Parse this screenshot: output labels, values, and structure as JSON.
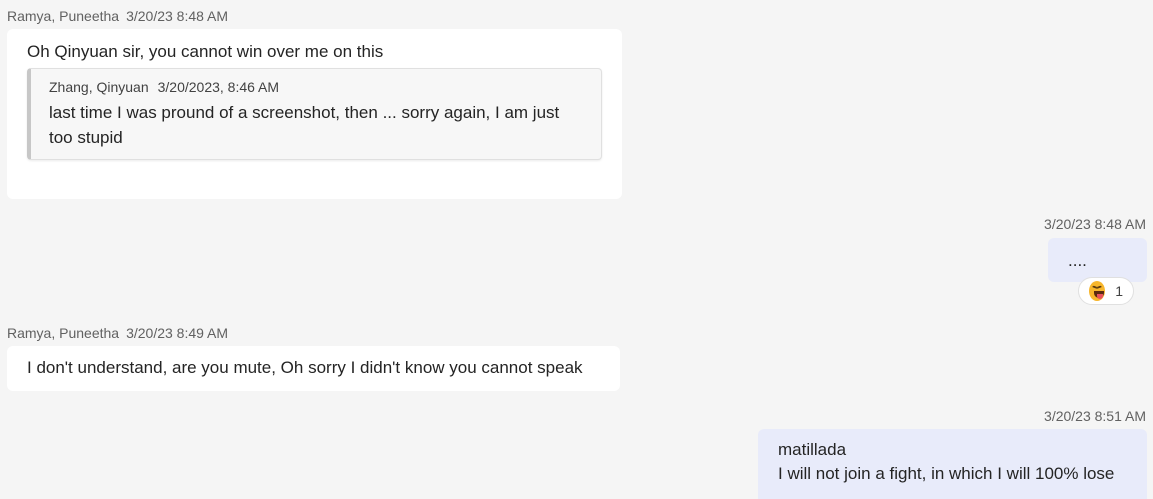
{
  "messages": [
    {
      "author": "Ramya, Puneetha",
      "time": "3/20/23 8:48 AM",
      "text": "Oh Qinyuan sir, you cannot win over me on this",
      "quote": {
        "author": "Zhang, Qinyuan",
        "time": "3/20/2023, 8:46 AM",
        "line1": "last time I was pround of a screenshot, then ... sorry again, I am just",
        "line2": "too stupid"
      }
    },
    {
      "time": "3/20/23 8:48 AM",
      "text": "....",
      "reaction": {
        "icon": "laughing-tongue-emoji-icon",
        "count": "1"
      }
    },
    {
      "author": "Ramya, Puneetha",
      "time": "3/20/23 8:49 AM",
      "text": "I don't understand, are you mute, Oh sorry I didn't know you cannot speak"
    },
    {
      "time": "3/20/23 8:51 AM",
      "line1": "matillada",
      "line2": "I will not join a fight, in which I will 100% lose"
    }
  ],
  "colors": {
    "background": "#f5f5f5",
    "incoming_bubble": "#ffffff",
    "outgoing_bubble": "#e8ebfa"
  }
}
